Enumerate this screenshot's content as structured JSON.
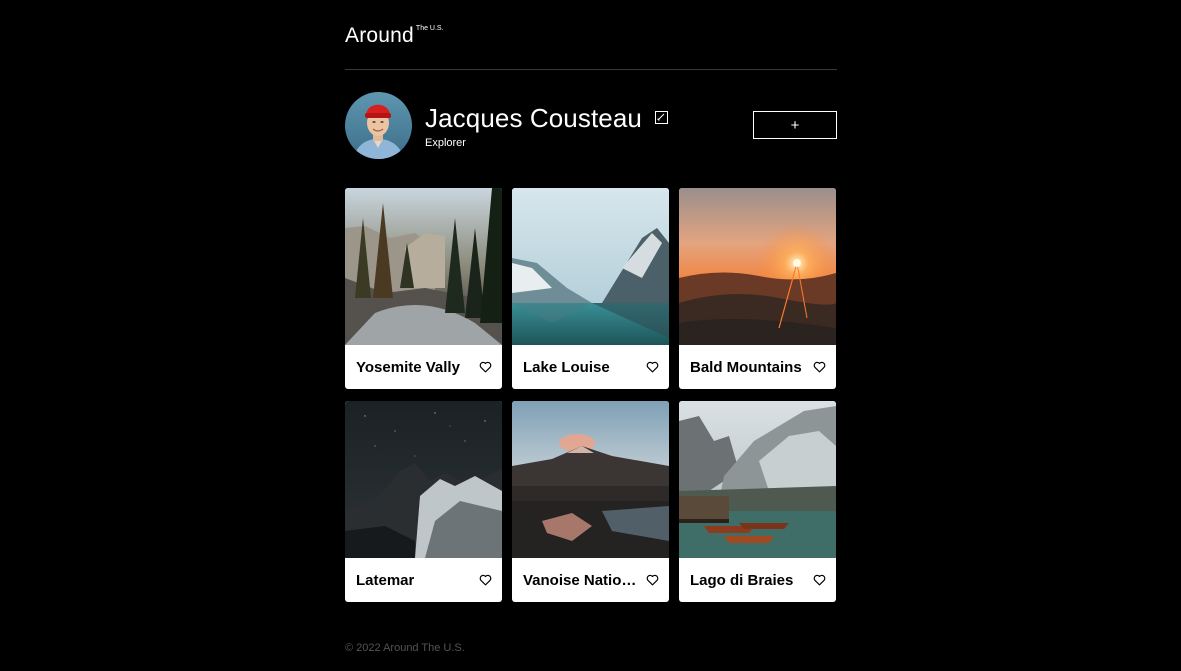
{
  "header": {
    "logo_text": "Around",
    "logo_sup": "The U.S."
  },
  "profile": {
    "name": "Jacques Cousteau",
    "job": "Explorer",
    "edit_icon": "edit-icon",
    "add_label": "+"
  },
  "cards": [
    {
      "title": "Yosemite Vally",
      "liked": false
    },
    {
      "title": "Lake Louise",
      "liked": false
    },
    {
      "title": "Bald Mountains",
      "liked": false
    },
    {
      "title": "Latemar",
      "liked": false
    },
    {
      "title": "Vanoise National Park",
      "liked": false
    },
    {
      "title": "Lago di Braies",
      "liked": false
    }
  ],
  "footer": {
    "text": "© 2022 Around The U.S."
  },
  "colors": {
    "background": "#000000",
    "card": "#ffffff",
    "divider": "#3a3a3a",
    "footer_text": "#545454"
  }
}
